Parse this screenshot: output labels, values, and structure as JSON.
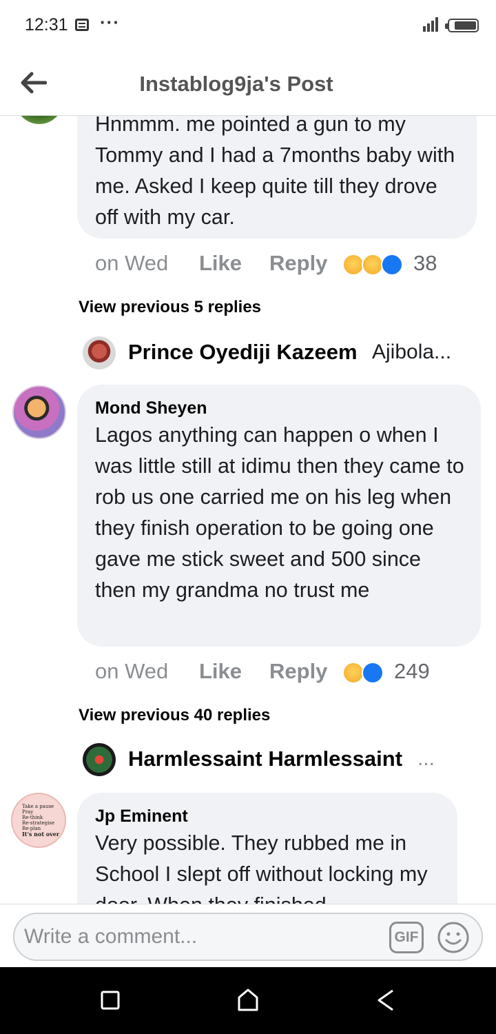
{
  "status_bar": {
    "time": "12:31",
    "dots": "···"
  },
  "header": {
    "title": "Instablog9ja's Post"
  },
  "comments": [
    {
      "text": "Hnmmm. me pointed a gun to my Tommy and I had a 7months baby with me. Asked I keep quite till they drove off with my car.",
      "time": "on Wed",
      "like": "Like",
      "reply": "Reply",
      "reaction_count": "38",
      "view_previous": "View previous 5 replies",
      "last_reply_name": "Prince Oyediji Kazeem",
      "last_reply_snippet": "Ajibola..."
    },
    {
      "author": "Mond Sheyen",
      "text": "Lagos anything can happen o when I was little still at idimu then they came to rob us one carried me on his leg when they finish operation to be going one gave me stick sweet and 500 since then my grandma no trust me",
      "time": "on Wed",
      "like": "Like",
      "reply": "Reply",
      "reaction_count": "249",
      "view_previous": "View previous 40 replies",
      "last_reply_name": "Harmlessaint Harmlessaint",
      "last_reply_snippet": "..."
    },
    {
      "author": "Jp Eminent",
      "text": "Very possible. They rubbed me in School I slept off without locking my door. When they finished",
      "avatar_text": [
        "Take a pause",
        "Pray",
        "Re-think",
        "Re-strategise",
        "Re-plan",
        "It's not over"
      ]
    }
  ],
  "comment_input": {
    "placeholder": "Write a comment...",
    "gif_label": "GIF"
  },
  "colors": {
    "bubble": "#f0f2f5",
    "like_blue": "#1877f2",
    "emoji_yellow": "#f7b125",
    "muted": "#8a8d91"
  },
  "icons": [
    "back-arrow-icon",
    "gif-icon",
    "emoji-icon",
    "square-recents-icon",
    "home-circle-icon",
    "back-triangle-icon"
  ]
}
